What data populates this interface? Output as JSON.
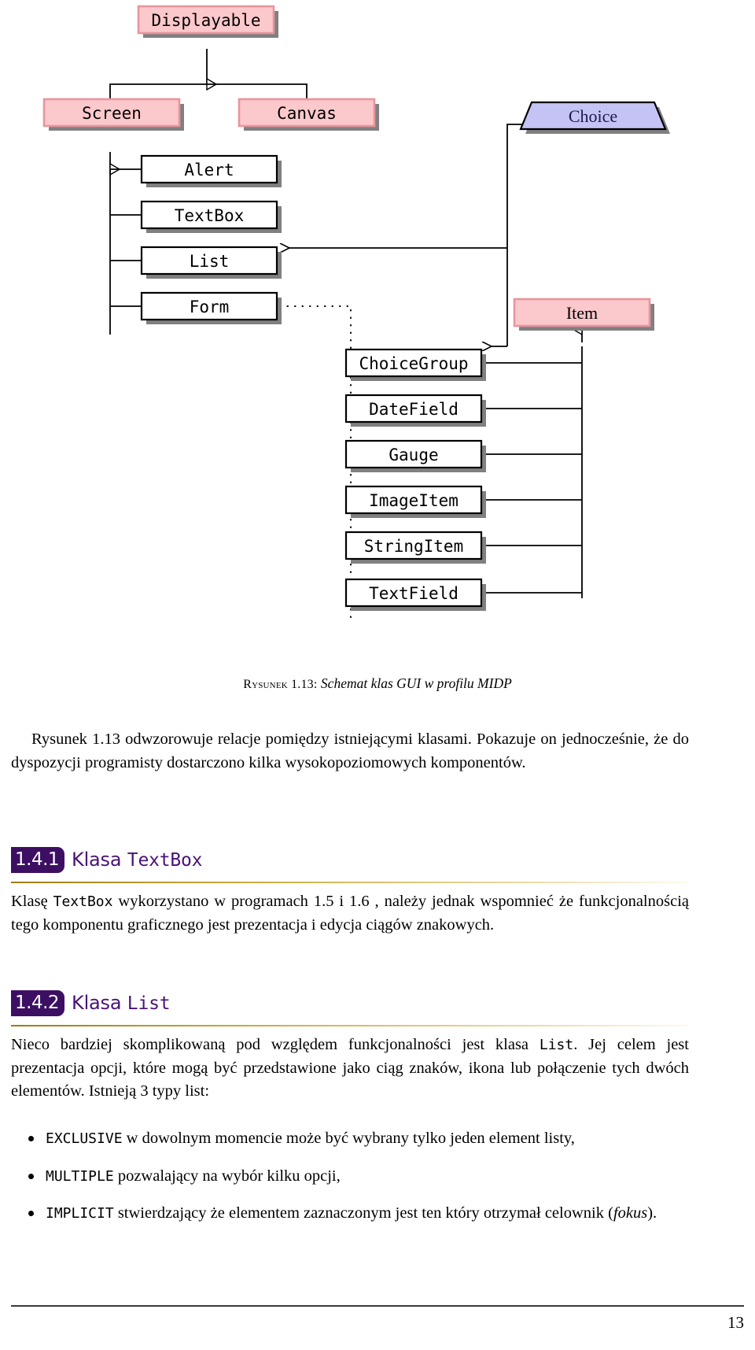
{
  "figure": {
    "caption_label": "Rysunek 1.13:",
    "caption_text": "Schemat klas GUI w profilu MIDP",
    "classes": {
      "displayable": "Displayable",
      "screen": "Screen",
      "canvas": "Canvas",
      "choice": "Choice",
      "alert": "Alert",
      "textbox": "TextBox",
      "list": "List",
      "form": "Form",
      "item": "Item",
      "choicegroup": "ChoiceGroup",
      "datefield": "DateField",
      "gauge": "Gauge",
      "imageitem": "ImageItem",
      "stringitem": "StringItem",
      "textfield": "TextField"
    },
    "colors": {
      "class_fill": "#fbc8cc",
      "class_border": "#e9959c",
      "interface_fill": "#c5c2f5",
      "plain_fill": "#ffffff",
      "line": "#000000",
      "shadow": "#808080"
    }
  },
  "paragraphs": {
    "intro": {
      "part1": "Rysunek 1.13 odwzorowuje relacje pomiędzy istniejącymi klasami. Pokazuje on jednocześnie, że do dyspozycji programisty dostarczono kilka wysokopoziomowych komponentów."
    },
    "textbox": {
      "a": "Klasę ",
      "code1": "TextBox",
      "b": " wykorzystano w programach 1.5 i 1.6 , należy jednak wspomnieć że funkcjonalnością tego komponentu graficznego jest prezentacja i edycja ciągów znakowych."
    },
    "list": {
      "a": "Nieco bardziej skomplikowaną pod względem funkcjonalności jest klasa ",
      "code1": "List",
      "b": ". Jej celem jest prezentacja opcji, które mogą być przedstawione jako ciąg znaków, ikona lub połączenie tych dwóch elementów. Istnieją 3 typy list:"
    }
  },
  "headings": [
    {
      "number": "1.4.1",
      "title_prefix": "Klasa ",
      "title_code": "TextBox"
    },
    {
      "number": "1.4.2",
      "title_prefix": "Klasa ",
      "title_code": "List"
    }
  ],
  "bullets": [
    {
      "code": "EXCLUSIVE",
      "text": " w dowolnym momencie może być wybrany tylko jeden element listy,"
    },
    {
      "code": "MULTIPLE",
      "text": " pozwalający na wybór kilku opcji,"
    },
    {
      "code": "IMPLICIT",
      "text": " stwierdzający że elementem zaznaczonym jest ten który otrzymał celownik (",
      "italic": "fokus",
      "tail": ")."
    }
  ],
  "footer": {
    "page_number": "13"
  }
}
